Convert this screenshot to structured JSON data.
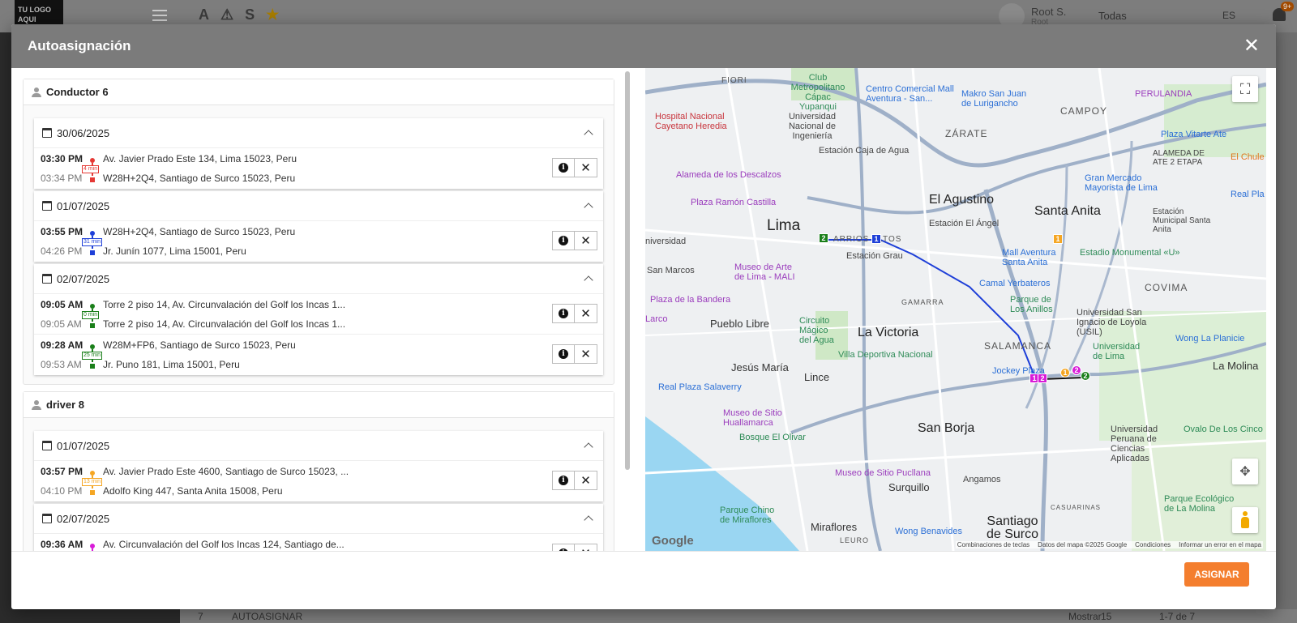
{
  "background": {
    "logo_text": "TU LOGO AQUI",
    "top_icons": [
      "A",
      "⚠",
      "S",
      "★"
    ],
    "user_name": "Root S.",
    "user_role": "Root",
    "company_filter": "Todas",
    "language": "ES",
    "notifications_badge": "9+",
    "bottom_count": "7",
    "bottom_autoassign": "AUTOASIGNAR",
    "bottom_show_label": "Mostrar",
    "bottom_page_size": "15",
    "bottom_range": "1-7 de 7"
  },
  "modal": {
    "title": "Autoasignación",
    "close_label": "✕",
    "assign_button": "ASIGNAR"
  },
  "drivers": [
    {
      "name": "Conductor 6",
      "groups": [
        {
          "date": "30/06/2025",
          "trips": [
            {
              "start_time": "03:30 PM",
              "end_time": "03:34 PM",
              "duration": "4 min",
              "origin": "Av. Javier Prado Este 134, Lima 15023, Peru",
              "destination": "W28H+2Q4, Santiago de Surco 15023, Peru",
              "color": "#e53935"
            }
          ]
        },
        {
          "date": "01/07/2025",
          "trips": [
            {
              "start_time": "03:55 PM",
              "end_time": "04:26 PM",
              "duration": "31 min",
              "origin": "W28H+2Q4, Santiago de Surco 15023, Peru",
              "destination": "Jr. Junín 1077, Lima 15001, Peru",
              "color": "#1e3fd8"
            }
          ]
        },
        {
          "date": "02/07/2025",
          "trips": [
            {
              "start_time": "09:05 AM",
              "end_time": "09:05 AM",
              "duration": "0 min",
              "origin": "Torre 2 piso 14, Av. Circunvalación del Golf los Incas 1...",
              "destination": "Torre 2 piso 14, Av. Circunvalación del Golf los Incas 1...",
              "color": "#1a7f1a"
            },
            {
              "start_time": "09:28 AM",
              "end_time": "09:53 AM",
              "duration": "25 min",
              "origin": "W28M+FP6, Santiago de Surco 15023, Peru",
              "destination": "Jr. Puno 181, Lima 15001, Peru",
              "color": "#1a7f1a"
            }
          ]
        }
      ]
    },
    {
      "name": "driver 8",
      "groups": [
        {
          "date": "01/07/2025",
          "trips": [
            {
              "start_time": "03:57 PM",
              "end_time": "04:10 PM",
              "duration": "13 min",
              "origin": "Av. Javier Prado Este 4600, Santiago de Surco 15023, ...",
              "destination": "Adolfo King 447, Santa Anita 15008, Peru",
              "color": "#f5a623"
            }
          ]
        },
        {
          "date": "02/07/2025",
          "trips": [
            {
              "start_time": "09:36 AM",
              "end_time": "",
              "duration": "",
              "origin": "Av. Circunvalación del Golf los Incas 124, Santiago de...",
              "destination": "",
              "color": "#d81bd8"
            }
          ]
        }
      ]
    }
  ],
  "map": {
    "labels": {
      "lima": "Lima",
      "el_agustino": "El Agustino",
      "santa_anita": "Santa Anita",
      "la_victoria": "La Victoria",
      "san_borja": "San Borja",
      "santiago_de_surco": "Santiago de Surco",
      "jesus_maria": "Jesús María",
      "lince": "Lince",
      "pueblo_libre": "Pueblo Libre",
      "la_molina": "La Molina",
      "surquillo": "Surquillo",
      "miraflores": "Miraflores",
      "zarate": "ZÁRATE",
      "campoy": "CAMPOY",
      "covima": "COVIMA",
      "salamanca": "SALAMANCA",
      "fiori": "FIORI",
      "barrios_altos": "ARRIOS  ALTOS",
      "gamarra": "GAMARRA",
      "angamos": "Angamos",
      "estacion_grau": "Estación Grau",
      "estacion_el_angel": "Estación El Ángel",
      "estacion_caja_de_agua": "Estación Caja de Agua",
      "hospital": "Hospital Nacional Cayetano Heredia",
      "club_metropolitano": "Club Metropolitano Cápac Yupanqui",
      "uni": "Universidad Nacional de Ingeniería",
      "mall_aventura_san": "Centro Comercial Mall Aventura - San...",
      "makro": "Makro San Juan de Lurigancho",
      "perulandia": "PERULANDIA",
      "plaza_vitarte": "Plaza Vitarte Ate",
      "alameda_ate": "ALAMEDA DE ATE 2 ETAPA",
      "gran_mercado": "Gran Mercado Mayorista de Lima",
      "real_plaza": "Real Pla",
      "alameda_descalzos": "Alameda de los Descalzos",
      "plaza_ramon_castilla": "Plaza Ramón Castilla",
      "museo_arte_lima": "Museo de Arte de Lima - MALI",
      "mall_aventura_santa_anita": "Mall Aventura Santa Anita",
      "estadio_monumental": "Estadio Monumental «U»",
      "camal_yerbateros": "Camal Yerbateros",
      "parque_anillos": "Parque de Los Anillos",
      "universidad_lima": "Universidad de Lima",
      "usil": "Universidad San Ignacio de Loyola (USIL)",
      "wong_planicie": "Wong La Planicie",
      "circuito_magico": "Circuito Mágico del Agua",
      "villa_deportiva": "Villa Deportiva Nacional",
      "jockey_plaza": "Jockey Plaza",
      "real_plaza_salaverry": "Real Plaza Salaverry",
      "museo_huallamarca": "Museo de Sitio Huallamarca",
      "bosque_olivar": "Bosque El Olivar",
      "museo_pucllana": "Museo de Sitio Pucllana",
      "parque_chino": "Parque Chino de Miraflores",
      "wong_benavides": "Wong Benavides",
      "ovalo_cinco": "Ovalo De Los Cinco",
      "upc": "Universidad Peruana de Ciencias Aplicadas",
      "parque_ecologico": "Parque Ecológico de La Molina",
      "plaza_bandera": "Plaza de la Bandera",
      "larco": "Larco",
      "el_chule": "El Chule",
      "estacion_municipal": "Estación Municipal Santa Anita",
      "casuarinas": "CASUARINAS",
      "leuro": "LEURO",
      "san_marcos": "San Marcos",
      "universidad_label": "niversidad"
    },
    "markers": [
      {
        "label": "2",
        "color": "#1a7f1a",
        "shape": "square"
      },
      {
        "label": "1",
        "color": "#1e3fd8",
        "shape": "square"
      },
      {
        "label": "1",
        "color": "#f5a623",
        "shape": "square"
      },
      {
        "label": "1",
        "color": "#d81bd8",
        "shape": "square"
      },
      {
        "label": "2",
        "color": "#d81bd8",
        "shape": "square"
      },
      {
        "label": "1",
        "color": "#f5a623",
        "shape": "round"
      },
      {
        "label": "2",
        "color": "#d81bd8",
        "shape": "round"
      },
      {
        "label": "2",
        "color": "#1a7f1a",
        "shape": "round"
      }
    ],
    "google_logo": "Google",
    "attribution": {
      "shortcuts": "Combinaciones de teclas",
      "data": "Datos del mapa ©2025 Google",
      "terms": "Condiciones",
      "report": "Informar un error en el mapa"
    }
  }
}
